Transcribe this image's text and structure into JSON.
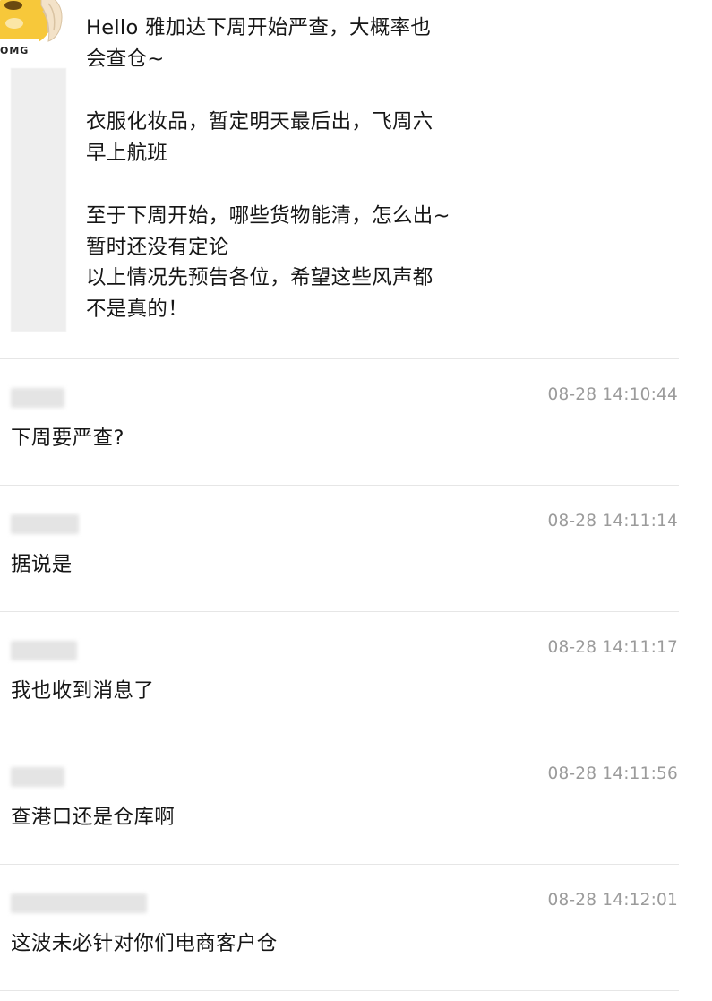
{
  "post": {
    "avatar_icon": "omg-emoji-sticker-icon",
    "avatar_badge": "OMG",
    "lines": [
      "Hello 雅加达下周开始严查，大概率也",
      "会查仓~",
      "",
      "衣服化妆品，暂定明天最后出，飞周六",
      "早上航班",
      "",
      "至于下周开始，哪些货物能清，怎么出~",
      "暂时还没有定论",
      "以上情况先预告各位，希望这些风声都",
      "不是真的！"
    ]
  },
  "comments": [
    {
      "time": "08-28 14:10:44",
      "text": "下周要严查?"
    },
    {
      "time": "08-28 14:11:14",
      "text": "据说是"
    },
    {
      "time": "08-28 14:11:17",
      "text": "我也收到消息了"
    },
    {
      "time": "08-28 14:11:56",
      "text": "查港口还是仓库啊"
    },
    {
      "time": "08-28 14:12:01",
      "text": "这波未必针对你们电商客户仓"
    }
  ]
}
